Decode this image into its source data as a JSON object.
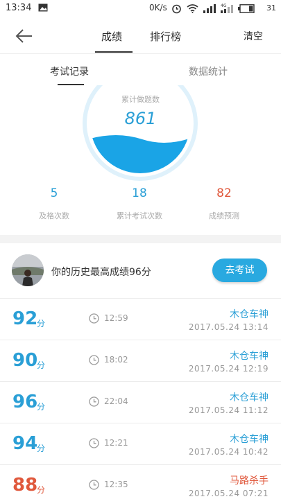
{
  "status_bar": {
    "time": "13:34",
    "net_speed": "0K/s",
    "battery": "31",
    "icons": [
      "image-icon",
      "alarm-icon",
      "wifi-icon",
      "signal-icon",
      "signal-4g-icon",
      "battery-icon"
    ]
  },
  "header": {
    "tabs": [
      "成绩",
      "排行榜"
    ],
    "active_tab": "成绩",
    "clear_label": "清空"
  },
  "subtabs": {
    "items": [
      "考试记录",
      "数据统计"
    ],
    "active": "考试记录"
  },
  "stats": {
    "circle_label": "累计做题数",
    "circle_value": "861",
    "items": [
      {
        "value": "5",
        "label": "及格次数",
        "color": "#2a9fd6"
      },
      {
        "value": "18",
        "label": "累计考试次数",
        "color": "#2a9fd6"
      },
      {
        "value": "82",
        "label": "成绩预测",
        "color": "#e0583c"
      }
    ]
  },
  "best": {
    "text": "你的历史最高成绩96分",
    "button_label": "去考试"
  },
  "records": [
    {
      "score": "92",
      "unit": "分",
      "duration": "12:59",
      "name": "木仓车神",
      "date": "2017.05.24  13:14",
      "color": "#2a9fd6"
    },
    {
      "score": "90",
      "unit": "分",
      "duration": "18:02",
      "name": "木仓车神",
      "date": "2017.05.24  12:19",
      "color": "#2a9fd6"
    },
    {
      "score": "96",
      "unit": "分",
      "duration": "22:04",
      "name": "木仓车神",
      "date": "2017.05.24  11:12",
      "color": "#2a9fd6"
    },
    {
      "score": "94",
      "unit": "分",
      "duration": "12:21",
      "name": "木仓车神",
      "date": "2017.05.24  10:42",
      "color": "#2a9fd6"
    },
    {
      "score": "88",
      "unit": "分",
      "duration": "12:35",
      "name": "马路杀手",
      "date": "2017.05.24  07:21",
      "color": "#e0583c"
    }
  ],
  "colors": {
    "accent": "#29a9e0",
    "warning": "#e0583c"
  }
}
